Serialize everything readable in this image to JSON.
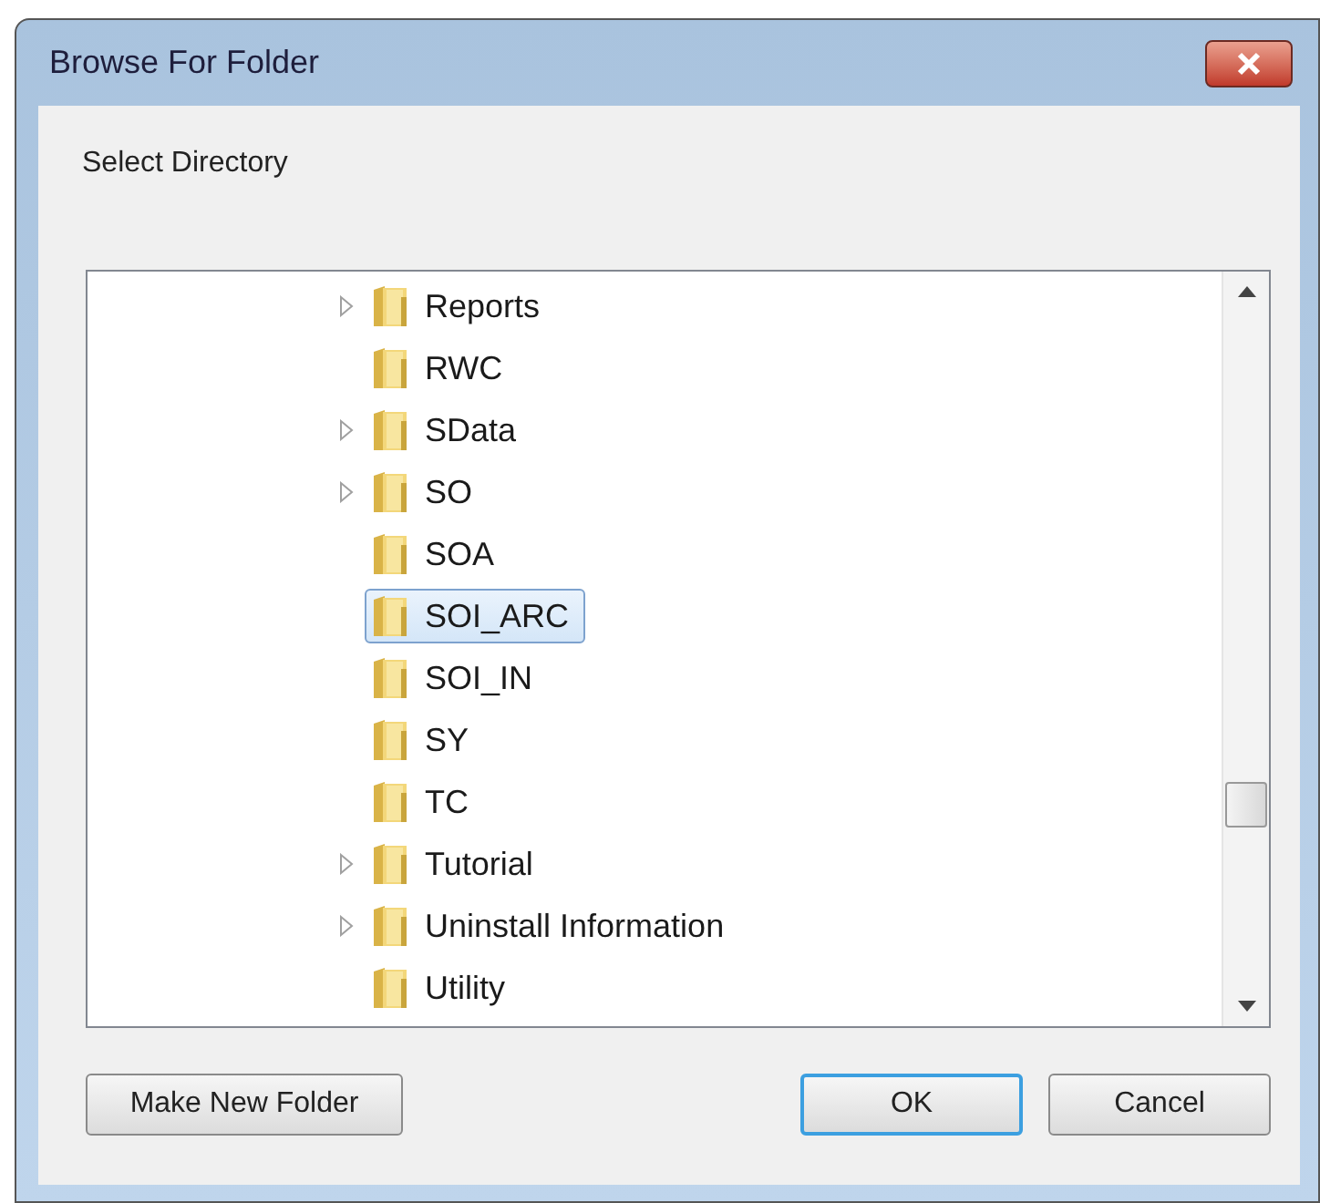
{
  "window": {
    "title": "Browse For Folder"
  },
  "prompt": "Select Directory",
  "tree": {
    "items": [
      {
        "name": "Reports",
        "expandable": true,
        "selected": false
      },
      {
        "name": "RWC",
        "expandable": false,
        "selected": false
      },
      {
        "name": "SData",
        "expandable": true,
        "selected": false
      },
      {
        "name": "SO",
        "expandable": true,
        "selected": false
      },
      {
        "name": "SOA",
        "expandable": false,
        "selected": false
      },
      {
        "name": "SOI_ARC",
        "expandable": false,
        "selected": true
      },
      {
        "name": "SOI_IN",
        "expandable": false,
        "selected": false
      },
      {
        "name": "SY",
        "expandable": false,
        "selected": false
      },
      {
        "name": "TC",
        "expandable": false,
        "selected": false
      },
      {
        "name": "Tutorial",
        "expandable": true,
        "selected": false
      },
      {
        "name": "Uninstall Information",
        "expandable": true,
        "selected": false
      },
      {
        "name": "Utility",
        "expandable": false,
        "selected": false
      }
    ]
  },
  "buttons": [
    {
      "label": "Make New Folder",
      "kind": "left",
      "default": false
    },
    {
      "label": "OK",
      "kind": "right",
      "default": true
    },
    {
      "label": "Cancel",
      "kind": "right",
      "default": false
    }
  ]
}
